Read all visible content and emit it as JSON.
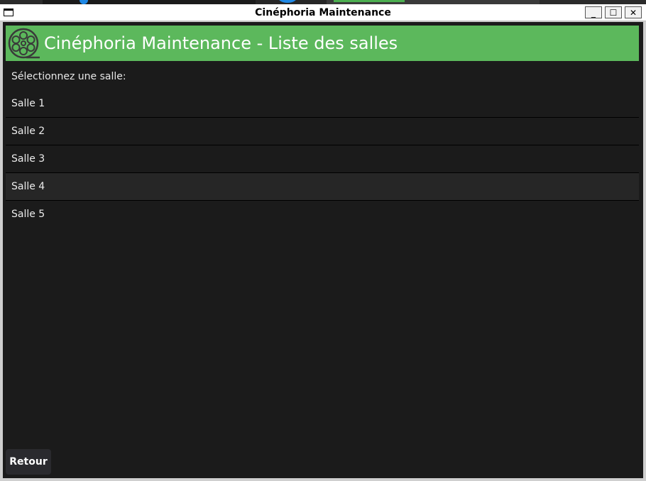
{
  "window": {
    "title": "Cinéphoria Maintenance",
    "minimize_label": "_",
    "maximize_label": "☐",
    "close_label": "✕"
  },
  "header": {
    "title": "Cinéphoria Maintenance - Liste des salles",
    "logo_icon": "film-reel-icon",
    "background": "#5cb85c"
  },
  "prompt": "Sélectionnez une salle:",
  "rooms": [
    {
      "label": "Salle 1"
    },
    {
      "label": "Salle 2"
    },
    {
      "label": "Salle 3"
    },
    {
      "label": "Salle 4"
    },
    {
      "label": "Salle 5"
    }
  ],
  "selected_room": "Salle 4",
  "back_button": "Retour"
}
